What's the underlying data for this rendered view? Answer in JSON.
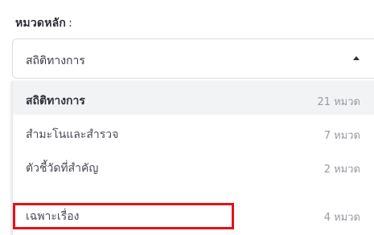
{
  "field": {
    "label": "หมวดหลัก",
    "colon": ":",
    "selected_value": "สถิติทางการ"
  },
  "dropdown": {
    "options": [
      {
        "label": "สถิติทางการ",
        "count": "21 หมวด"
      },
      {
        "label": "สำมะโนและสำรวจ",
        "count": "7 หมวด"
      },
      {
        "label": "ตัวชี้วัดที่สำคัญ",
        "count": "2 หมวด"
      },
      {
        "label": "เฉพาะเรื่อง",
        "count": "4 หมวด"
      }
    ]
  },
  "colors": {
    "highlight": "#e1131a",
    "selected_bg": "#f2f3f5"
  },
  "icons": {
    "caret": "caret-up-icon"
  }
}
